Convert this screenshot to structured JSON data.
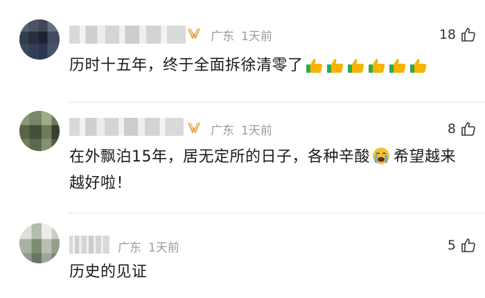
{
  "comments": [
    {
      "location": "广东",
      "time": "1天前",
      "likes": "18",
      "text": "历时十五年，终于全面拆徐清零了",
      "emoji": [
        "thumbs-up-emoji",
        "thumbs-up-emoji",
        "thumbs-up-emoji",
        "thumbs-up-emoji",
        "thumbs-up-emoji",
        "thumbs-up-emoji"
      ]
    },
    {
      "location": "广东",
      "time": "1天前",
      "likes": "8",
      "text_before": "在外飘泊15年，居无定所的日子，各种辛酸",
      "emoji": "loudly-crying-emoji",
      "text_after": "希望越来越好啦！"
    },
    {
      "location": "广东",
      "time": "1天前",
      "likes": "5",
      "text": "历史的见证"
    }
  ],
  "colors": {
    "meta": "#9a9a9a",
    "badge": "#e0a64a",
    "thumbs": "#f6b400",
    "cuff": "#2fa84f"
  }
}
